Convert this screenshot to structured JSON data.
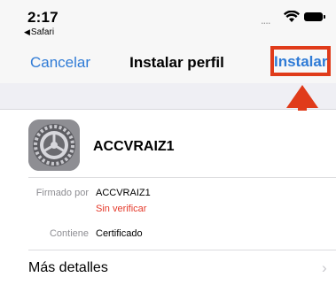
{
  "status_bar": {
    "time": "2:17",
    "back_app": "Safari",
    "signal": "....",
    "back_glyph": "◀"
  },
  "nav": {
    "cancel_label": "Cancelar",
    "title": "Instalar perfil",
    "install_label": "Instalar"
  },
  "profile": {
    "name": "ACCVRAIZ1",
    "icon": "gear-icon"
  },
  "details": {
    "signed_by_label": "Firmado por",
    "signed_by_value": "ACCVRAIZ1",
    "verification_status": "Sin verificar",
    "contains_label": "Contiene",
    "contains_value": "Certificado",
    "more_details_label": "Más detalles",
    "chevron": "›"
  },
  "colors": {
    "link_blue": "#2f7bd6",
    "highlight_red": "#e03b1a",
    "warning_red": "#e5392a"
  }
}
